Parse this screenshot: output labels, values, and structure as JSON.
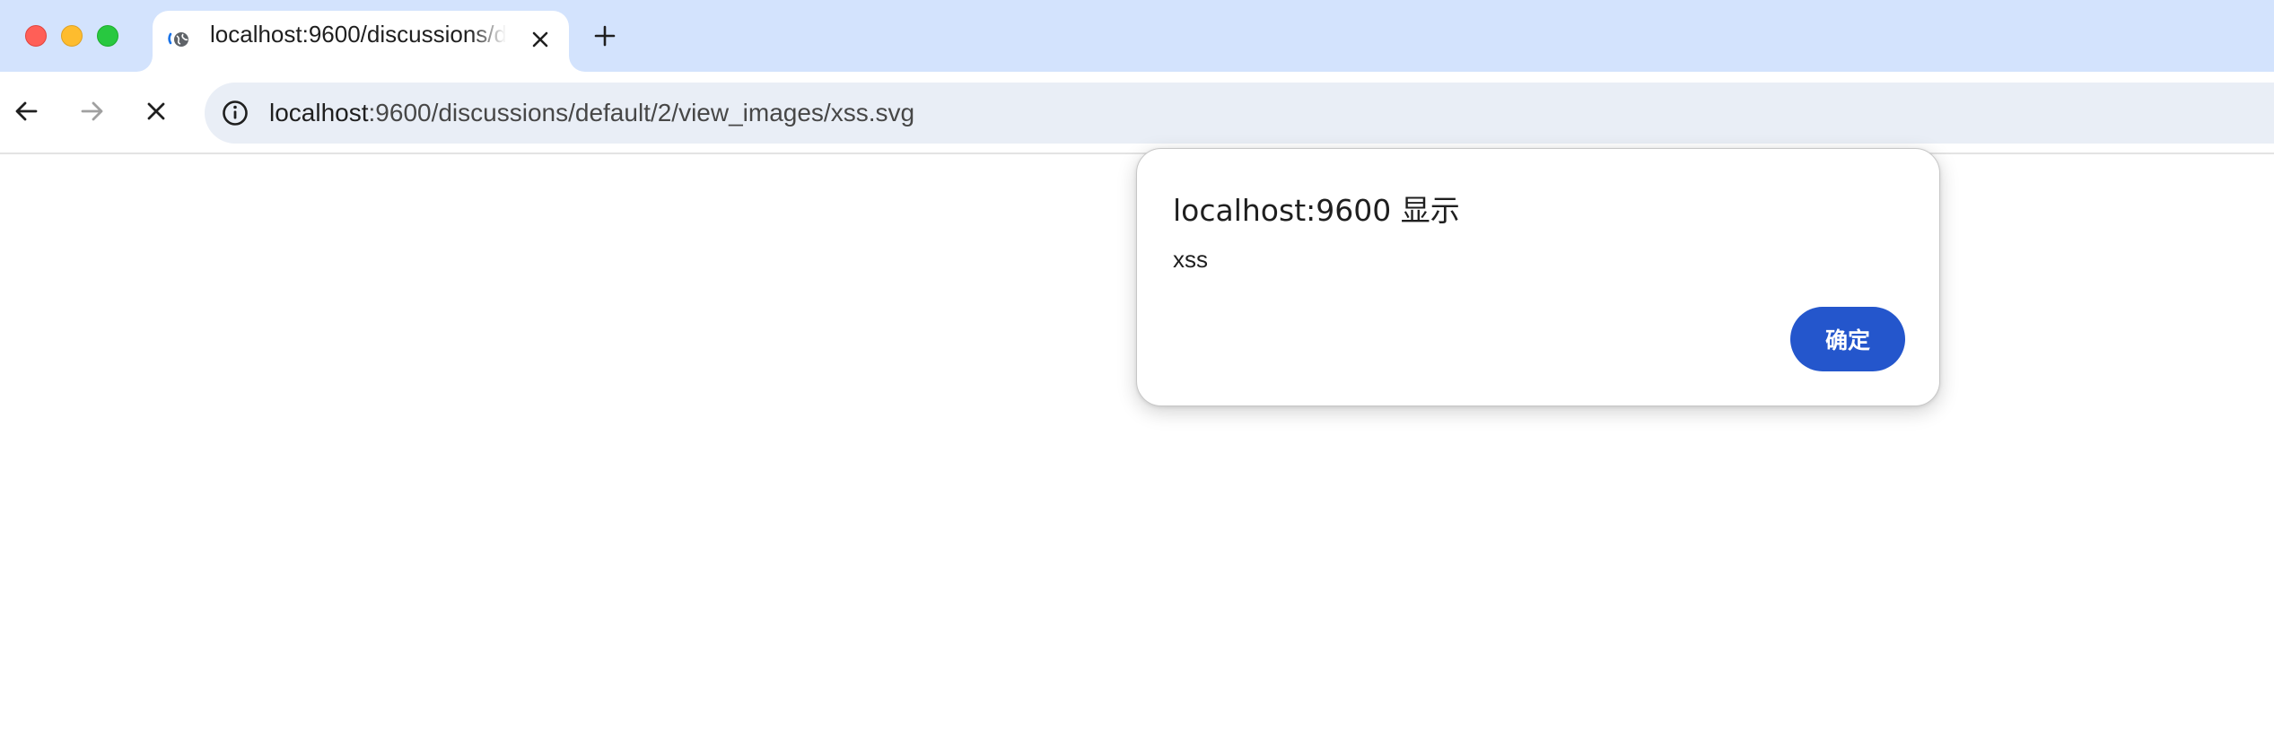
{
  "browser": {
    "tab": {
      "title": "localhost:9600/discussions/default/2/view_images/xss.svg",
      "favicon": "loading-globe-icon"
    },
    "new_tab_icon": "plus-icon",
    "toolbar": {
      "back_icon": "arrow-left-icon",
      "forward_icon": "arrow-right-icon",
      "stop_icon": "close-icon",
      "site_info_icon": "info-icon"
    },
    "address_bar": {
      "host": "localhost",
      "rest": ":9600/discussions/default/2/view_images/xss.svg"
    }
  },
  "dialog": {
    "title": "localhost:9600 显示",
    "message": "xss",
    "ok_label": "确定"
  },
  "colors": {
    "tabstrip_bg": "#d3e3fd",
    "omnibox_bg": "#e9eef6",
    "ok_button": "#2456cc",
    "traffic_close": "#ff5f57",
    "traffic_min": "#febc2e",
    "traffic_max": "#28c840"
  }
}
